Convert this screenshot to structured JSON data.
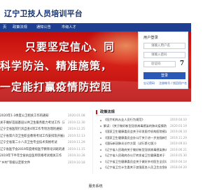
{
  "header": {
    "title": "辽宁卫技人员培训平台"
  },
  "nav": {
    "items": [
      "页",
      "政策法规",
      "通知公告",
      "市级人才"
    ]
  },
  "banner": {
    "lines": [
      "只要坚定信心、同",
      "科学防治、精准施策，",
      "一定能打赢疫情防控阻"
    ]
  },
  "login": {
    "title": "用户登录",
    "username_placeholder": "请输入用户名",
    "password_placeholder": "请输入密码",
    "captcha_placeholder": "验证码",
    "captcha_value": "7",
    "button": "登录",
    "forgot": "忘记密码",
    "register": "注册帐号 / 找回用户名"
  },
  "news": [
    {
      "title": "2020年1-3季度公卫相关工作的通知",
      "date": "2020.01.08"
    },
    {
      "title": "关于做好首届基层公共卫生服务能力考试工作（2020",
      "date": "2019.12.30"
    },
    {
      "title": "辽宁全省医院行风自查4项工作专项治理的通知",
      "date": "2019.12.25"
    },
    {
      "title": "辽宁省第六次卫生职业教育考试工作安排及开展通知",
      "date": "2019.12.13"
    },
    {
      "title": "辽宁全省第二十八次卫生专业技术资格考试",
      "date": "2019.11.29"
    },
    {
      "title": "辽宁省医学会2019年度继续医学教育培训班的通知",
      "date": "2019.11.15"
    },
    {
      "title": "2019年下半年全省执业医师资格考试相关工作 ",
      "date": "2019.10.28"
    },
    {
      "title": "“乡村”等级认定新文件",
      "date": "2019.10.18"
    }
  ],
  "policy": {
    "title": "政策法规",
    "items": [
      {
        "title": "《医疗机构从业人员行为规范》",
        "date": "2019.04.10"
      },
      {
        "title": "解读：《关于做好新型冠状病毒感染的肺炎疫情防控中",
        "date": "2020.03.19"
      },
      {
        "title": "《国家卫生健康委员会关于印发医疗机构医院感染...",
        "date": "2019.06.10"
      },
      {
        "title": "《国家卫生健康委员会办公厅关于进一步加强新型冠状",
        "date": "2019.11.29"
      },
      {
        "title": "《国际新冠肺炎诊疗方案（试行第七版）》",
        "date": "2019.09.03"
      },
      {
        "title": "《辽宁省人民政府关于做好新型冠状病毒感染肺炎疫",
        "date": "2019.06.21"
      },
      {
        "title": "《辽宁省人民政府办公厅转发省卫生健康委关于",
        "date": "2019.05.30"
      },
      {
        "title": "《辽宁省卫生健康委员会关于做好乡村医生全员培训",
        "date": "2019.04.14"
      },
      {
        "title": "《辽宁省卫生计生委关于加强医务人员卫生应急能力",
        "date": "2018.04.20"
      }
    ]
  },
  "service": {
    "title": "服务系统"
  },
  "colors": {
    "primary": "#1e3f91",
    "accent": "#c91a1a",
    "button": "#2a58b6"
  }
}
